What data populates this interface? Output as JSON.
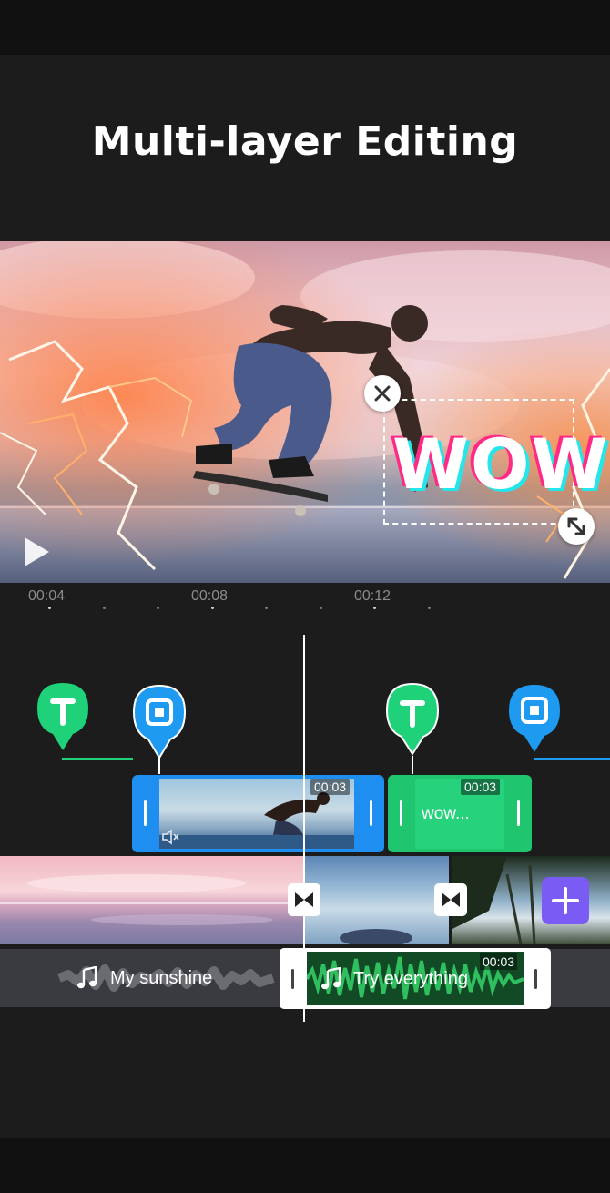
{
  "headline": "Multi-layer Editing",
  "preview": {
    "sticker_text": "WOW",
    "close_icon": "close-icon",
    "resize_icon": "resize-icon",
    "play_icon": "play-icon"
  },
  "ruler": {
    "labels": [
      "00:04",
      "00:08",
      "00:12"
    ]
  },
  "markers": {
    "text_icon": "text-icon",
    "overlay_icon": "overlay-icon",
    "text_color": "#1fd27a",
    "overlay_color": "#1e9bf0"
  },
  "overlay_clips": [
    {
      "type": "video",
      "duration": "00:03",
      "muted_icon": "mute-icon"
    },
    {
      "type": "text",
      "duration": "00:03",
      "label": "wow..."
    }
  ],
  "main_track": {
    "transition_icon": "transition-icon",
    "add_icon": "plus-icon",
    "accent": "#7a5cf5"
  },
  "audio_track": [
    {
      "label": "My sunshine",
      "icon": "music-note-icon"
    },
    {
      "label": "Try everything",
      "icon": "music-note-icon",
      "duration": "00:03",
      "selected": true
    }
  ]
}
